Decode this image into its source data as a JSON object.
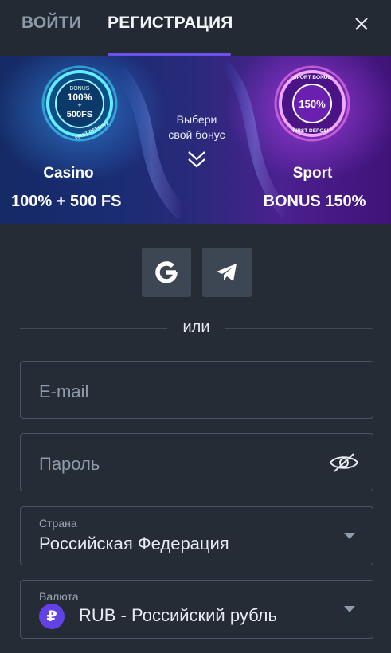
{
  "tabs": {
    "login": "ВОЙТИ",
    "register": "РЕГИСТРАЦИЯ",
    "active": "register"
  },
  "banner": {
    "casino": {
      "badge_top": "BONUS",
      "badge_main": "100%",
      "badge_plus": "+",
      "badge_fs": "500FS",
      "badge_ring": "FIRST DEPOSIT",
      "label": "Casino",
      "offer": "100% + 500 FS"
    },
    "choose_text_line1": "Выбери",
    "choose_text_line2": "свой бонус",
    "sport": {
      "badge_ring_top": "SPORT BONUS",
      "badge_main": "150%",
      "badge_ring_bottom": "FIRST DEPOSIT",
      "label": "Sport",
      "offer": "BONUS 150%"
    }
  },
  "divider": {
    "text": "или"
  },
  "form": {
    "email": {
      "placeholder": "E-mail",
      "value": ""
    },
    "password": {
      "placeholder": "Пароль",
      "value": ""
    },
    "country": {
      "label": "Страна",
      "value": "Российская Федерация"
    },
    "currency": {
      "label": "Валюта",
      "value": "RUB - Российский рубль",
      "icon_symbol": "₽"
    }
  },
  "colors": {
    "background": "#252c35",
    "accent": "#6e4ff0",
    "field_border": "#4a5461",
    "social_bg": "#3d4753",
    "ruble_badge": "#6242e6"
  },
  "icons": {
    "close": "close-icon",
    "google": "google-icon",
    "telegram": "telegram-icon",
    "eye": "eye-off-icon",
    "caret": "chevron-down-icon"
  }
}
